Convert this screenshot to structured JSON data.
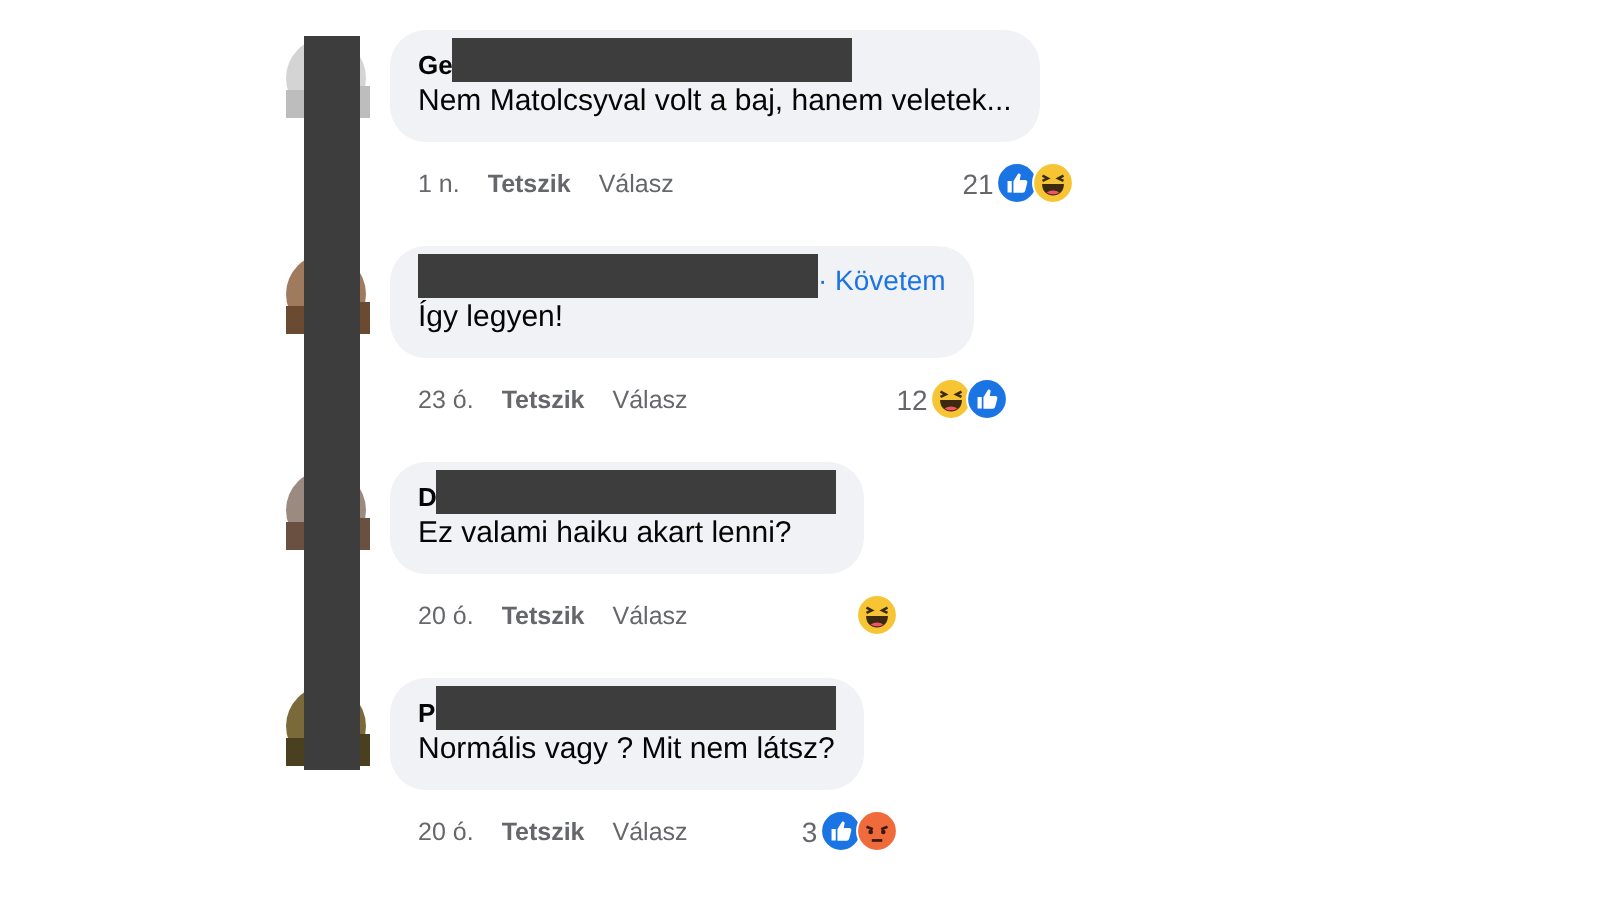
{
  "avatar_column_redacted": true,
  "comments": [
    {
      "author": "Ge",
      "name_redacted": true,
      "text": "Nem Matolcsyval volt a baj, hanem veletek...",
      "time": "1 n.",
      "like_label": "Tetszik",
      "reply_label": "Válasz",
      "reaction_count": "21",
      "reactions": [
        {
          "kind": "like"
        },
        {
          "kind": "haha"
        }
      ]
    },
    {
      "name_redacted": true,
      "follow_link": "· Követem",
      "text": "Így legyen!",
      "time": "23 ó.",
      "like_label": "Tetszik",
      "reply_label": "Válasz",
      "reaction_count": "12",
      "reactions": [
        {
          "kind": "haha"
        },
        {
          "kind": "like"
        }
      ]
    },
    {
      "author": "D",
      "name_redacted": true,
      "text": "Ez valami haiku akart lenni?",
      "time": "20 ó.",
      "like_label": "Tetszik",
      "reply_label": "Válasz",
      "reactions": [
        {
          "kind": "haha"
        }
      ]
    },
    {
      "author": "P",
      "name_redacted": true,
      "text": "Normális vagy ? Mit nem látsz?",
      "time": "20 ó.",
      "like_label": "Tetszik",
      "reply_label": "Válasz",
      "reaction_count": "3",
      "reactions": [
        {
          "kind": "like"
        },
        {
          "kind": "angry"
        }
      ]
    }
  ]
}
